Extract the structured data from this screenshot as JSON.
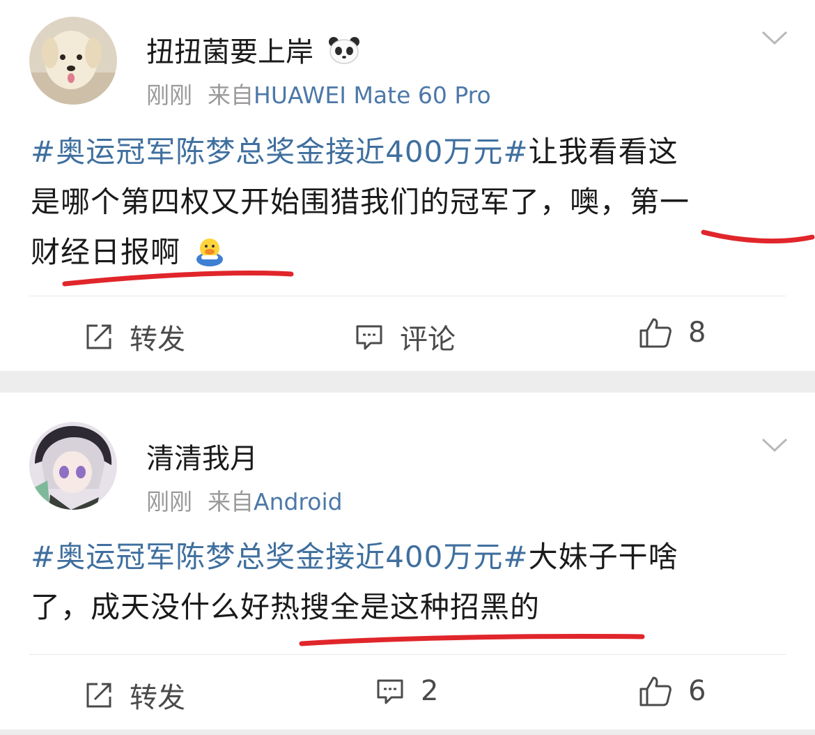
{
  "posts": [
    {
      "username": "扭扭菌要上岸",
      "username_emoji": "panda-emoji",
      "time": "刚刚",
      "source_prefix": "来自",
      "source": "HUAWEI Mate 60 Pro",
      "topic": "#奥运冠军陈梦总奖金接近400万元#",
      "text_line1": "让我看看这",
      "text_line2": "是哪个第四权又开始围猎我们的冠军了，噢，第一",
      "text_line3": "财经日报啊",
      "text_emoji": "duck-emoji",
      "actions": {
        "repost": "转发",
        "comment": "评论",
        "like": "8"
      }
    },
    {
      "username": "清清我月",
      "time": "刚刚",
      "source_prefix": "来自",
      "source": "Android",
      "topic": "#奥运冠军陈梦总奖金接近400万元#",
      "text_line1": "大妹子干啥",
      "text_line2": "了，成天没什么好热搜全是这种招黑的",
      "actions": {
        "repost": "转发",
        "comment": "2",
        "like": "6"
      }
    }
  ],
  "colors": {
    "topic": "#3f6f9e",
    "source": "#4d78a8",
    "meta": "#9a9a9a",
    "underline": "#e0262b",
    "separator": "#ededed"
  },
  "icons": [
    "chevron-down-icon",
    "repost-icon",
    "comment-icon",
    "thumbs-up-icon"
  ]
}
